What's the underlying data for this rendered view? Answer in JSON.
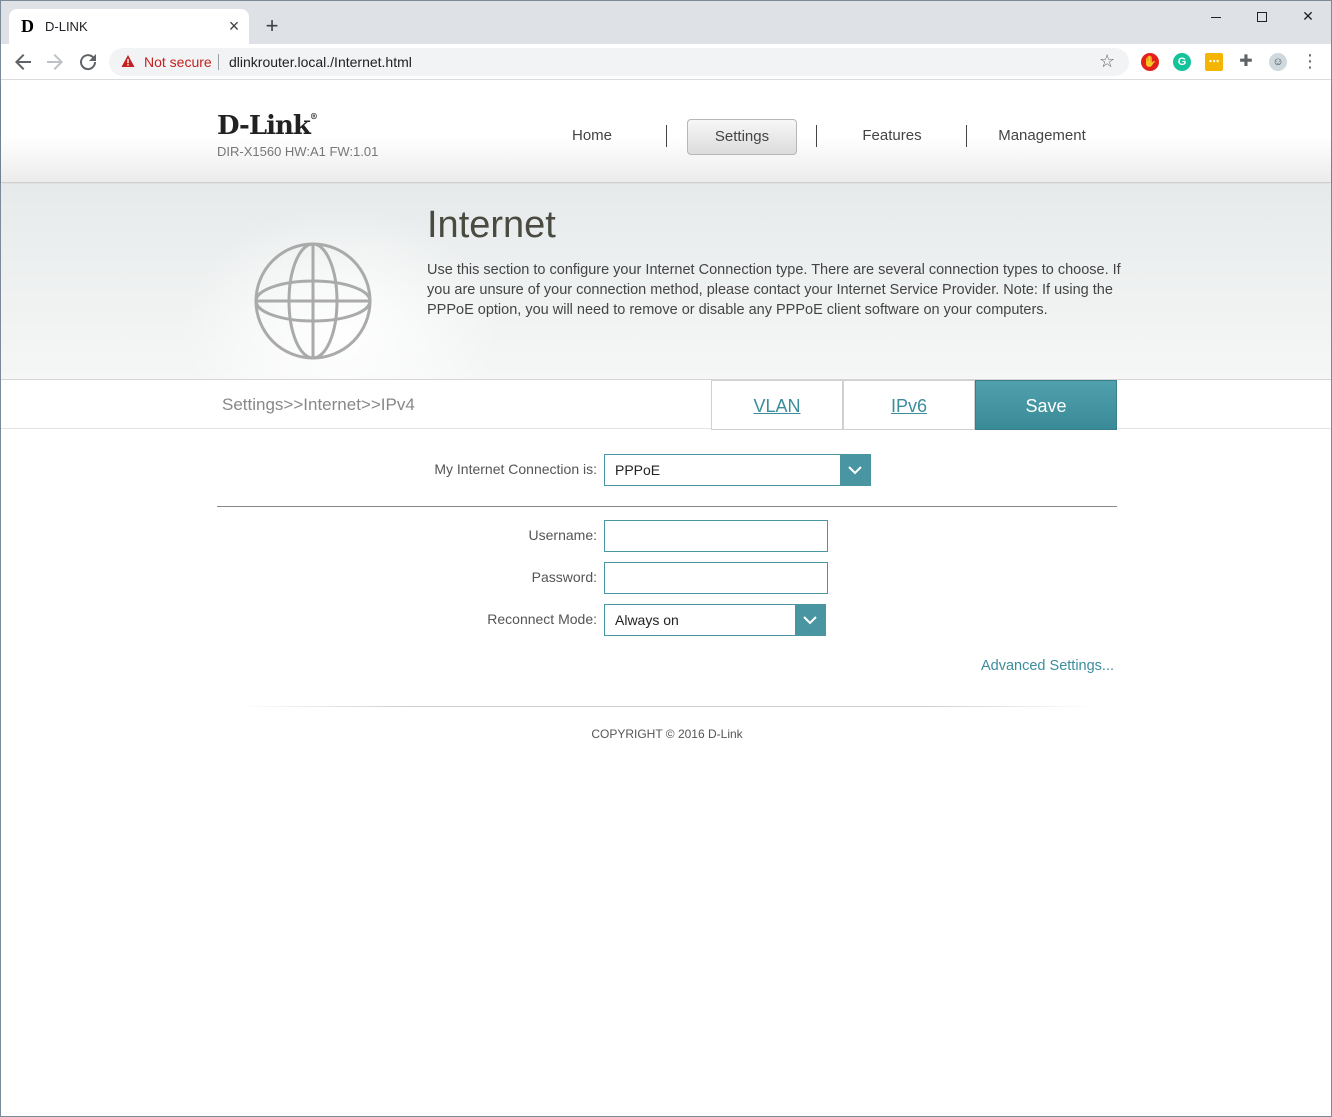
{
  "browser": {
    "tab_title": "D-LINK",
    "tab_favicon": "D",
    "close_tab": "×",
    "new_tab": "+",
    "security_label": "Not secure",
    "url": "dlinkrouter.local./Internet.html",
    "icons": [
      "back-arrow-icon",
      "forward-arrow-icon",
      "reload-icon",
      "warning-icon",
      "star-icon",
      "extensions-icon",
      "menu-icon"
    ]
  },
  "header": {
    "logo": "D-Link",
    "logo_mark": "®",
    "model": "DIR-X1560 HW:A1 FW:1.01",
    "nav": [
      {
        "label": "Home"
      },
      {
        "label": "Settings"
      },
      {
        "label": "Features"
      },
      {
        "label": "Management"
      }
    ]
  },
  "hero": {
    "title": "Internet",
    "description": "Use this section to configure your Internet Connection type. There are several connection types to choose. If you are unsure of your connection method, please contact your Internet Service Provider. Note: If using the PPPoE option, you will need to remove or disable any PPPoE client software on your computers."
  },
  "subbar": {
    "breadcrumb": "Settings>>Internet>>IPv4",
    "vlan": "VLAN",
    "ipv6": "IPv6",
    "save": "Save"
  },
  "form": {
    "connection_label": "My Internet Connection is:",
    "connection_value": "PPPoE",
    "username_label": "Username:",
    "username_value": "",
    "password_label": "Password:",
    "password_value": "",
    "reconnect_label": "Reconnect Mode:",
    "reconnect_value": "Always on",
    "advanced": "Advanced Settings..."
  },
  "footer": {
    "copyright": "COPYRIGHT © 2016 D-Link"
  },
  "colors": {
    "accent": "#4a95a2",
    "save_bg": "#3a8a97",
    "not_secure": "#c5221f"
  }
}
